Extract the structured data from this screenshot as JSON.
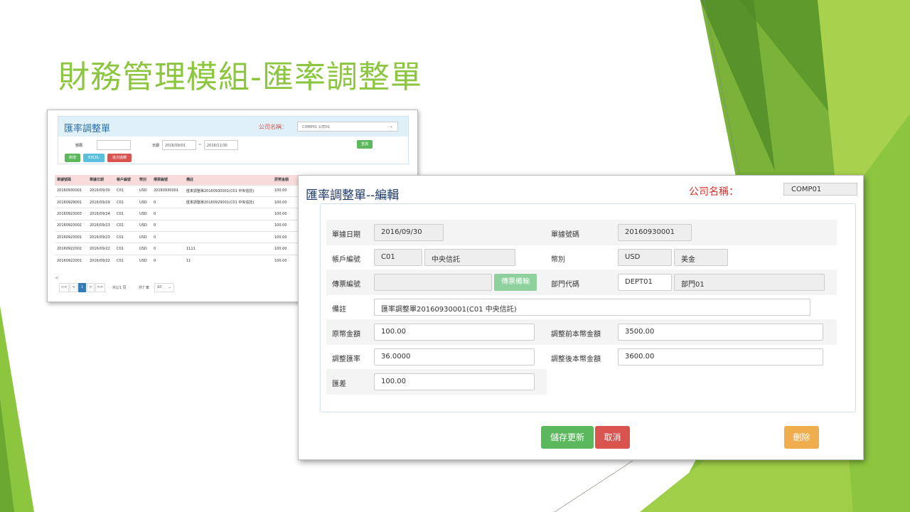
{
  "slide": {
    "title": "財務管理模組-匯率調整單",
    "colors": {
      "accent": "#8cc63f",
      "dark_green": "#5a9a2a",
      "light_green": "#a3d14a"
    }
  },
  "list_view": {
    "title": "匯率調整單",
    "company_label": "公司名稱：",
    "company_select": "COMP01 公司01",
    "filter": {
      "doc_no_label": "號碼",
      "date_label": "日期",
      "date_from": "2016/09/01",
      "date_sep": "~",
      "date_to": "2016/11/30",
      "search_button": "查詢"
    },
    "buttons": {
      "add": "新增",
      "excel": "EXCEL",
      "batch": "批次拋轉"
    },
    "columns": [
      "單據號碼",
      "單據日期",
      "帳戶編號",
      "幣別",
      "傳票編號",
      "備註",
      "原幣金額"
    ],
    "rows": [
      [
        "20160930001",
        "2016/09/30",
        "C01",
        "USD",
        "20160930001",
        "匯率調整單20160930001(C01 中央信託)",
        "100.00"
      ],
      [
        "20160929001",
        "2016/09/29",
        "C01",
        "USD",
        "0",
        "匯率調整單20160929001(C01 中央信託)",
        "100.00"
      ],
      [
        "20160923003",
        "2016/09/24",
        "C01",
        "USD",
        "0",
        "",
        "100.00"
      ],
      [
        "20160923002",
        "2016/09/23",
        "C01",
        "USD",
        "0",
        "",
        "100.00"
      ],
      [
        "20160923001",
        "2016/09/23",
        "C01",
        "USD",
        "0",
        "",
        "100.00"
      ],
      [
        "20160922002",
        "2016/09/22",
        "C01",
        "USD",
        "0",
        "1111",
        "100.00"
      ],
      [
        "20160922001",
        "2016/09/22",
        "C01",
        "USD",
        "0",
        "11",
        "100.00"
      ]
    ],
    "scroll_arrow": "<",
    "pager": {
      "first": "<<",
      "prev": "<",
      "current": "1",
      "next": ">",
      "last": ">>",
      "page_info": "共1/1 頁",
      "record_info": "共7 筆",
      "page_size": "10"
    }
  },
  "edit_view": {
    "title": "匯率調整單--編輯",
    "company_label": "公司名稱：",
    "company_value": "COMP01",
    "fields": {
      "doc_date_label": "單據日期",
      "doc_date": "2016/09/30",
      "doc_no_label": "單據號碼",
      "doc_no": "20160930001",
      "account_label": "帳戶編號",
      "account_code": "C01",
      "account_name": "中央信託",
      "currency_label": "幣別",
      "currency_code": "USD",
      "currency_name": "美金",
      "voucher_label": "傳票編號",
      "voucher_no": "",
      "voucher_button": "傳票備輸",
      "dept_label": "部門代碼",
      "dept_code": "DEPT01",
      "dept_name": "部門01",
      "note_label": "備註",
      "note": "匯率調整單20160930001(C01 中央信託)",
      "orig_amount_label": "原幣金額",
      "orig_amount": "100.00",
      "pre_adj_label": "調整前本幣金額",
      "pre_adj": "3500.00",
      "adj_rate_label": "調整匯率",
      "adj_rate": "36.0000",
      "post_adj_label": "調整後本幣金額",
      "post_adj": "3600.00",
      "diff_label": "匯差",
      "diff": "100.00"
    },
    "buttons": {
      "save": "儲存更新",
      "cancel": "取消",
      "delete": "刪除"
    },
    "colors": {
      "save": "#5cb85c",
      "cancel": "#d9534f",
      "delete": "#f0ad4e"
    }
  }
}
